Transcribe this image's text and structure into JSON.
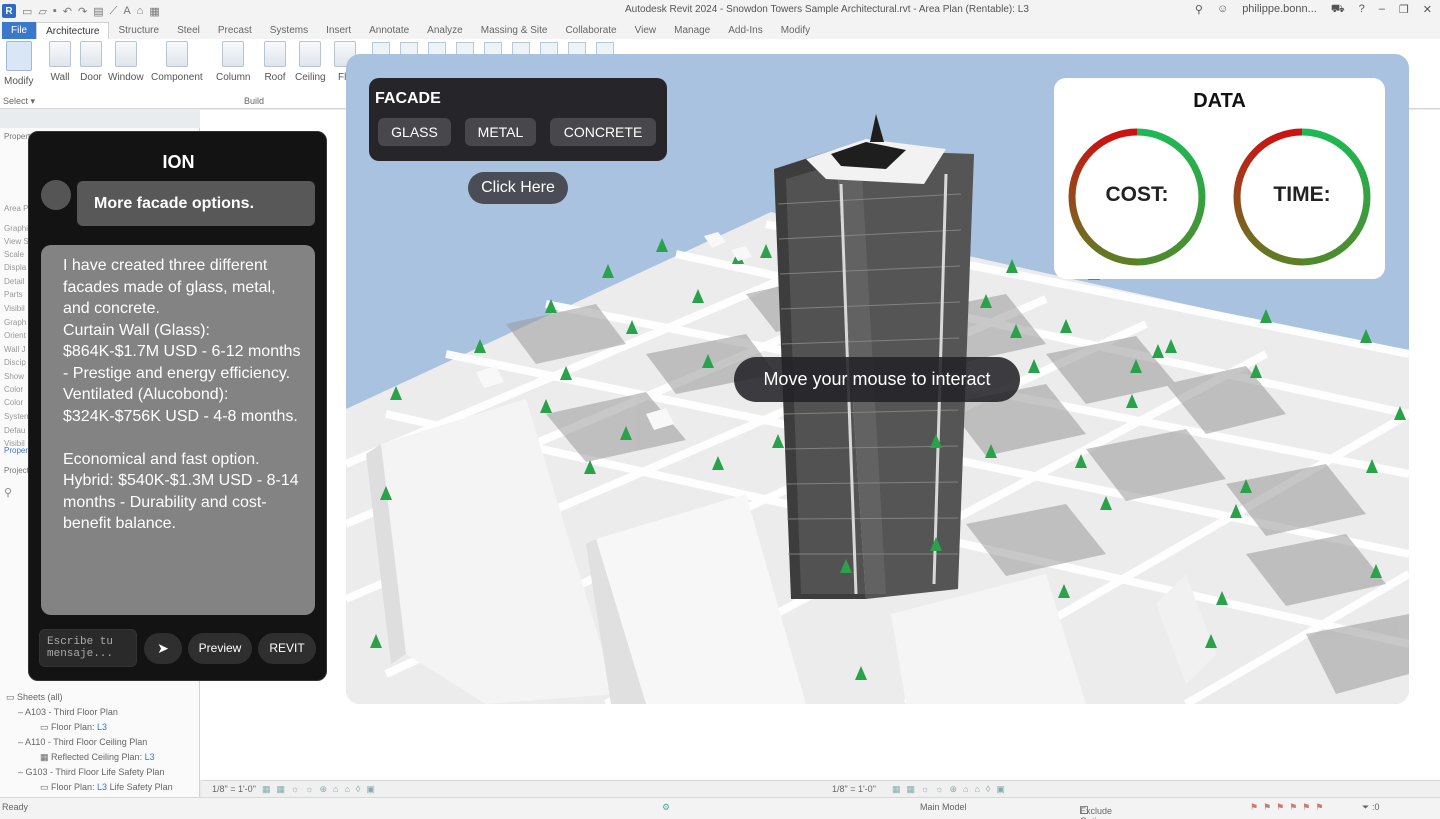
{
  "window": {
    "app_badge": "R",
    "title": "Autodesk Revit 2024 - Snowdon Towers Sample Architectural.rvt - Area Plan (Rentable): L3",
    "user": "philippe.bonn...",
    "help": "?"
  },
  "ribbon_tabs": [
    "File",
    "Architecture",
    "Structure",
    "Steel",
    "Precast",
    "Systems",
    "Insert",
    "Annotate",
    "Analyze",
    "Massing & Site",
    "Collaborate",
    "View",
    "Manage",
    "Add-Ins",
    "Modify"
  ],
  "ribbon_tools": [
    "Modify",
    "Wall",
    "Door",
    "Window",
    "Component",
    "Column",
    "Roof",
    "Ceiling",
    "Flo"
  ],
  "ribbon_groups": {
    "select": "Select ▾",
    "build": "Build"
  },
  "props_panel": {
    "header": "Propert",
    "lines": [
      "Area P",
      "Graphi",
      "View S",
      "Scale",
      "Displa",
      "Detail",
      "Parts",
      "Visibil",
      "Graph",
      "Orient",
      "Wall J",
      "Discip",
      "Show",
      "Color",
      "Color",
      "Systen",
      "Defau",
      "Visibil"
    ],
    "footer_link": "Propert",
    "browser_header": "Project",
    "tree": [
      {
        "text": "Sheets (all)",
        "link": ""
      },
      {
        "text": "A103 - Third Floor Plan",
        "link": ""
      },
      {
        "text": "Floor Plan: ",
        "link": "L3"
      },
      {
        "text": "A110 - Third Floor Ceiling Plan",
        "link": ""
      },
      {
        "text": "Reflected Ceiling Plan: ",
        "link": "L3"
      },
      {
        "text": "G103 - Third Floor Life Safety Plan",
        "link": ""
      },
      {
        "text": "Floor Plan: ",
        "link": "L3",
        "suffix": " Life Safety Plan"
      }
    ]
  },
  "facade": {
    "title": "FACADE",
    "options": [
      "GLASS",
      "METAL",
      "CONCRETE"
    ],
    "click_here": "Click Here"
  },
  "data_panel": {
    "title": "DATA",
    "cost_label": "COST:",
    "time_label": "TIME:",
    "gauge_colors": {
      "red": "#cc1111",
      "green": "#1db954"
    }
  },
  "viewport": {
    "hint": "Move your mouse to interact"
  },
  "ion": {
    "title": "ION",
    "user_message": "More facade options.",
    "bot_message": [
      "I have created three different facades made of glass, metal, and concrete.",
      "Curtain Wall (Glass): $864K-$1.7M USD - 6-12 months - Prestige and energy efficiency.",
      "Ventilated (Alucobond): $324K-$756K USD - 4-8 months.",
      "",
      "Economical and fast option. Hybrid: $540K-$1.3M USD - 8-14 months - Durability and cost-benefit balance."
    ],
    "input_placeholder": "Escribe tu mensaje...",
    "send_icon": "➤",
    "preview_label": "Preview",
    "revit_label": "REVIT"
  },
  "view_bar": {
    "scale_left": "1/8\" = 1'-0\"",
    "scale_right": "1/8\" = 1'-0\""
  },
  "status_bar": {
    "left": "Ready",
    "model": "Main Model",
    "exclude": "Exclude Options",
    "filter": ":0"
  }
}
